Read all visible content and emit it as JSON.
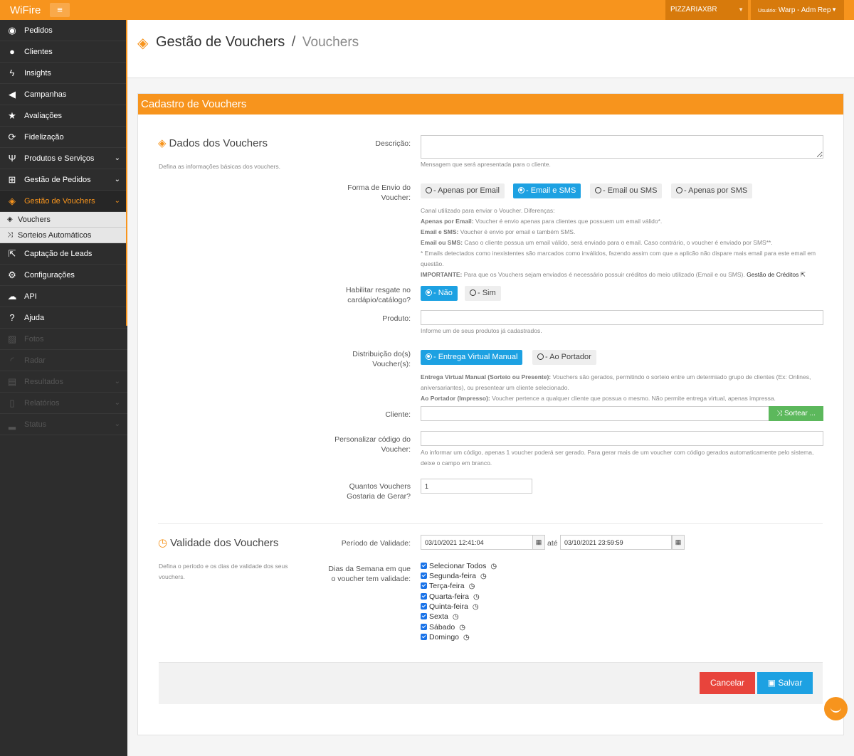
{
  "topbar": {
    "brand": "WiFire",
    "store": "PIZZARIAXBR",
    "user_prefix": "Usuário:",
    "user_name": "Warp - Adm Rep"
  },
  "sidebar": {
    "items": [
      {
        "label": "Pedidos",
        "icon": "dashboard-icon"
      },
      {
        "label": "Clientes",
        "icon": "users-icon"
      },
      {
        "label": "Insights",
        "icon": "bolt-icon"
      },
      {
        "label": "Campanhas",
        "icon": "megaphone-icon"
      },
      {
        "label": "Avaliações",
        "icon": "star-icon"
      },
      {
        "label": "Fidelização",
        "icon": "refresh-icon"
      },
      {
        "label": "Produtos e Serviços",
        "icon": "utensils-icon"
      },
      {
        "label": "Gestão de Pedidos",
        "icon": "cart-icon"
      },
      {
        "label": "Gestão de Vouchers",
        "icon": "ticket-icon"
      },
      {
        "label": "Captação de Leads",
        "icon": "external-icon"
      },
      {
        "label": "Configurações",
        "icon": "gears-icon"
      },
      {
        "label": "API",
        "icon": "cloud-icon"
      },
      {
        "label": "Ajuda",
        "icon": "question-icon"
      },
      {
        "label": "Fotos",
        "icon": "image-icon"
      },
      {
        "label": "Radar",
        "icon": "rss-icon"
      },
      {
        "label": "Resultados",
        "icon": "table-icon"
      },
      {
        "label": "Relatórios",
        "icon": "file-icon"
      },
      {
        "label": "Status",
        "icon": "signal-icon"
      }
    ],
    "subitems": [
      {
        "label": "Vouchers",
        "icon": "ticket-icon"
      },
      {
        "label": "Sorteios Automáticos",
        "icon": "shuffle-icon"
      }
    ]
  },
  "header": {
    "title": "Gestão de Vouchers",
    "separator": "/",
    "crumb": "Vouchers"
  },
  "card": {
    "title": "Cadastro de Vouchers"
  },
  "dados": {
    "title": "Dados dos Vouchers",
    "desc": "Defina as informações básicas dos vouchers."
  },
  "form": {
    "descricao": {
      "label": "Descrição:",
      "value": "",
      "help": "Mensagem que será apresentada para o cliente."
    },
    "envio": {
      "label_1": "Forma de Envio do",
      "label_2": "Voucher:",
      "options": [
        "- Apenas por Email",
        "- Email e SMS",
        "- Email ou SMS",
        "- Apenas por SMS"
      ],
      "selected": "- Email e SMS",
      "help_intro": "Canal utilizado para enviar o Voucher. Diferenças:",
      "help_email_b": "Apenas por Email:",
      "help_email": " Voucher é envio apenas para clientes que possuem um email válido*.",
      "help_esms_b": "Email e SMS:",
      "help_esms": " Voucher é envio por email e também SMS.",
      "help_ousms_b": "Email ou SMS:",
      "help_ousms": " Caso o cliente possua um email válido, será enviado para o email. Caso contrário, o voucher é enviado por SMS**.",
      "help_star_1": "* Emails detectados como inexistentes são marcados como inválidos, fazendo assim com que a aplicão não dispare mais email para este email em",
      "help_star_2": "questão.",
      "help_imp_b": "IMPORTANTE:",
      "help_imp": " Para que os Vouchers sejam enviados é necessário possuir créditos do meio utilizado (Email e ou SMS).",
      "link": "Gestão de Créditos"
    },
    "resgate": {
      "label_1": "Habilitar resgate no",
      "label_2": "cardápio/catálogo?",
      "options": [
        "- Não",
        "- Sim"
      ],
      "selected": "- Não"
    },
    "produto": {
      "label": "Produto:",
      "value": "",
      "help": "Informe um de seus produtos já cadastrados."
    },
    "distribuicao": {
      "label_1": "Distribuição do(s)",
      "label_2": "Voucher(s):",
      "options": [
        "- Entrega Virtual Manual",
        "- Ao Portador"
      ],
      "selected": "- Entrega Virtual Manual",
      "help_1_b": "Entrega Virtual Manual (Sorteio ou Presente):",
      "help_1": " Vouchers são gerados, permitindo o sorteio entre um determiado grupo de clientes (Ex: Onlines,",
      "help_1b": "aniversariantes), ou presentear um cliente selecionado.",
      "help_2_b": "Ao Portador (Impresso):",
      "help_2": " Voucher pertence a qualquer cliente que possua o mesmo. Não permite entrega virtual, apenas impressa."
    },
    "cliente": {
      "label": "Cliente:",
      "value": "",
      "sort_button": "Sortear ..."
    },
    "codigo": {
      "label_1": "Personalizar código do",
      "label_2": "Voucher:",
      "value": "",
      "help_1": "Ao informar um código, apenas 1 voucher poderá ser gerado. Para gerar mais de um voucher com código gerados automaticamente pelo sistema,",
      "help_2": "deixe o campo em branco."
    },
    "quantidade": {
      "label_1": "Quantos Vouchers",
      "label_2": "Gostaria de Gerar?",
      "value": "1"
    }
  },
  "validade": {
    "title": "Validade dos Vouchers",
    "desc_1": "Defina o período e os dias de validade dos seus",
    "desc_2": "vouchers.",
    "periodo_label": "Período de Validade:",
    "start": "03/10/2021 12:41:04",
    "ate": "até",
    "end": "03/10/2021 23:59:59",
    "dias_label_1": "Dias da Semana em que",
    "dias_label_2": "o voucher tem validade:",
    "days": [
      "Selecionar Todos",
      "Segunda-feira",
      "Terça-feira",
      "Quarta-feira",
      "Quinta-feira",
      "Sexta",
      "Sábado",
      "Domingo"
    ]
  },
  "actions": {
    "cancel": "Cancelar",
    "save": "Salvar"
  },
  "colors": {
    "accent": "#f7941d",
    "primary": "#1da1e2",
    "danger": "#e8443c",
    "success": "#5cb85c"
  }
}
